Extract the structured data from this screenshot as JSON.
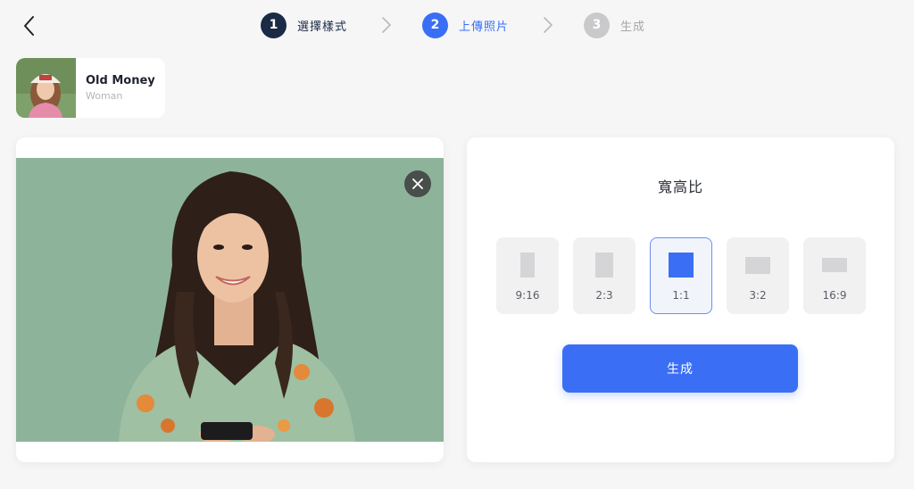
{
  "nav": {
    "back_icon": "chevron-left-icon"
  },
  "stepper": {
    "steps": [
      {
        "number": "1",
        "label": "選擇樣式",
        "state": "done"
      },
      {
        "number": "2",
        "label": "上傳照片",
        "state": "active"
      },
      {
        "number": "3",
        "label": "生成",
        "state": "pending"
      }
    ],
    "separator_icon": "chevron-right-icon"
  },
  "style_card": {
    "name": "Old Money",
    "category": "Woman"
  },
  "photo": {
    "close_icon": "close-icon"
  },
  "panel": {
    "title": "寬高比",
    "ratios": [
      {
        "label": "9:16",
        "selected": false
      },
      {
        "label": "2:3",
        "selected": false
      },
      {
        "label": "1:1",
        "selected": true
      },
      {
        "label": "3:2",
        "selected": false
      },
      {
        "label": "16:9",
        "selected": false
      }
    ],
    "generate_label": "生成"
  },
  "colors": {
    "accent": "#3a6ff5",
    "step_done": "#1b2a45",
    "step_pending": "#c9c9cc",
    "background": "#f6f6f7"
  }
}
